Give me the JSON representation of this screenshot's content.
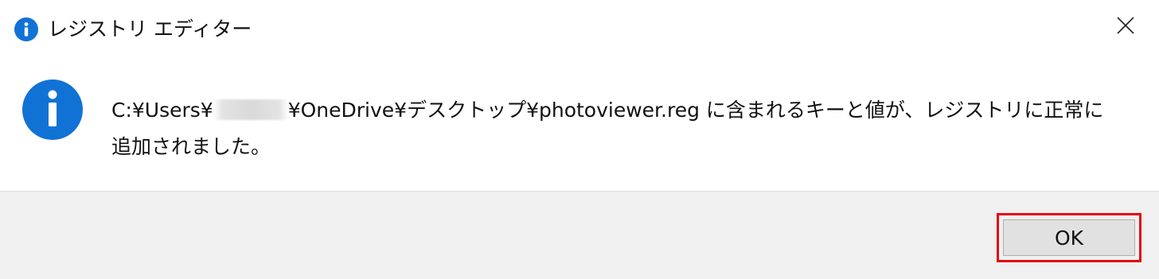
{
  "window": {
    "title": "レジストリ エディター",
    "title_icon": "info-icon",
    "close_icon": "close-icon"
  },
  "message": {
    "icon": "info-icon",
    "path_prefix": "C:¥Users¥",
    "path_suffix": "¥OneDrive¥デスクトップ¥photoviewer.reg に含まれるキーと値が、レジストリに正常に",
    "line2": "追加されました。"
  },
  "buttons": {
    "ok_label": "OK"
  },
  "colors": {
    "info_blue": "#1172d6",
    "highlight_red": "#e30613",
    "footer_bg": "#f0f0f0",
    "button_bg": "#e1e1e1"
  }
}
